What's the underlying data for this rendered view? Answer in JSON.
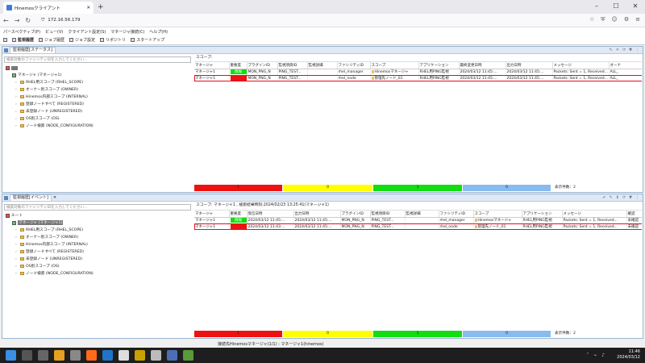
{
  "browser": {
    "tab_title": "Hinemosクライアント",
    "url": "172.16.56.179"
  },
  "menu": [
    "パースペクティブ(P)",
    "ビュー(V)",
    "クライアント設定(S)",
    "マネージャ接続(C)",
    "ヘルプ(H)"
  ],
  "perspectives": [
    "監視履歴",
    "ジョブ履歴",
    "ジョブ設定",
    "リポジトリ",
    "スタートアップ"
  ],
  "status_view": {
    "tab_label": "監視履歴[ステータス]",
    "filter_placeholder": "検索対象のファシリティIDを入力してください...",
    "scope_label": "スコープ:",
    "tree_nodes": [
      "マネージャ (マネージャ1)",
      "RHEL用スコープ (RHEL_SCOPE)",
      "オーナー別スコープ (OWNER)",
      "Hinemos内部スコープ (INTERNAL)",
      "登録ノードすべて (REGISTERED)",
      "未登録ノード (UNREGISTERED)",
      "OS別スコープ (OS)",
      "ノード検索 (NODE_CONFIGURATION)"
    ],
    "columns": [
      "マネージャ",
      "重要度",
      "プラグインID",
      "監視項目ID",
      "監視詳細",
      "ファシリティID",
      "スコープ",
      "アプリケーション",
      "最終変更日時",
      "出力日時",
      "メッセージ",
      "オーナ"
    ],
    "rows": [
      [
        "マネージャ1",
        "情報",
        "MON_PNG_N",
        "PING_TEST...",
        "",
        "rhel_manager",
        "Hinemosマネージャ",
        "RHEL用PING監視",
        "2024/03/12 11:45:...",
        "2024/03/12 11:45:...",
        "Packets: Sent = 1, Received...",
        "ALL_"
      ],
      [
        "マネージャ1",
        "",
        "MON_PNG_N",
        "PING_TEST...",
        "",
        "rhel_node",
        "管理先ノード_01",
        "RHEL用PING監視",
        "2024/03/12 11:45:...",
        "2024/03/12 11:45:...",
        "Packets: Sent = 1, Received...",
        "ALL_"
      ]
    ],
    "severity_bar": [
      "1",
      "0",
      "1",
      "0"
    ],
    "count_label": "表示件数：2"
  },
  "event_view": {
    "tab_label": "監視履歴[イベント]",
    "filter_placeholder": "検索対象のファシリティIDを入力してください...",
    "scope_label": "スコープ: マネージャ1 , 検索結果時刻:2024/02/23 13:25:41(マネージャ1)",
    "tree_root": "ルート",
    "tree_nodes": [
      "マネージャ (マネージャ1)",
      "RHEL用スコープ (RHEL_SCOPE)",
      "オーナー別スコープ (OWNER)",
      "Hinemos内部スコープ (INTERNAL)",
      "登録ノードすべて (REGISTERED)",
      "未登録ノード (UNREGISTERED)",
      "OS別スコープ (OS)",
      "ノード検索 (NODE_CONFIGURATION)"
    ],
    "columns": [
      "マネージャ",
      "重要度",
      "受信日時",
      "出力日時",
      "プラグインID",
      "監視項目ID",
      "監視詳細",
      "ファシリティID",
      "スコープ",
      "アプリケーション",
      "メッセージ",
      "確認"
    ],
    "rows": [
      [
        "マネージャ1",
        "情報",
        "2024/03/12 11:45:...",
        "2024/03/12 11:45:...",
        "MON_PNG_N",
        "PING_TEST...",
        "",
        "rhel_manager",
        "Hinemosマネージャ",
        "RHEL用PING監視",
        "Packets: Sent = 1, Received...",
        "未確認"
      ],
      [
        "マネージャ1",
        "",
        "2024/03/12 11:43:...",
        "2024/03/12 11:45:...",
        "MON_PNG_N",
        "PING_TEST...",
        "",
        "rhel_node",
        "管理先ノード_01",
        "RHEL用PING監視",
        "Packets: Sent = 1, Received...",
        "未確認"
      ]
    ],
    "severity_bar": [
      "1",
      "0",
      "1",
      "0"
    ],
    "count_label": "表示件数：2"
  },
  "app_status": "接続先Hinemosマネージャ(1/1) : マネージャ1(hinemos)",
  "clock": {
    "time": "11:46",
    "date": "2024/03/12"
  },
  "colors": {
    "critical": "#ee1111",
    "warning": "#ffff00",
    "info": "#11dd11",
    "unknown": "#88bbee",
    "highlight": "#e01020"
  }
}
